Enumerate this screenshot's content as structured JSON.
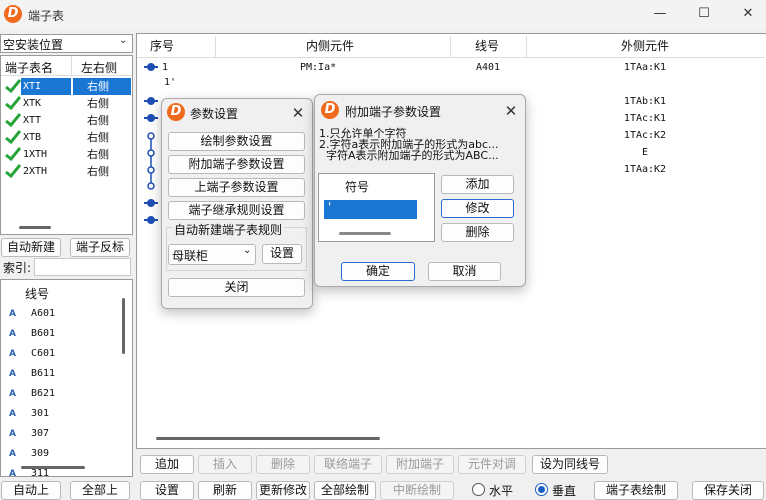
{
  "app": {
    "title": "端子表",
    "logo_letter": "D",
    "min_glyph": "—",
    "max_glyph": "☐",
    "close_glyph": "✕"
  },
  "left": {
    "location_select": "空安装位置",
    "table_headers": [
      "端子表名",
      "左右侧"
    ],
    "tables": [
      {
        "name": "XTI",
        "side": "右侧"
      },
      {
        "name": "XTK",
        "side": "右侧"
      },
      {
        "name": "XTT",
        "side": "右侧"
      },
      {
        "name": "XTB",
        "side": "右侧"
      },
      {
        "name": "1XTH",
        "side": "右侧"
      },
      {
        "name": "2XTH",
        "side": "右侧"
      }
    ],
    "auto_new_label": "自动新建",
    "reverse_label": "端子反标",
    "index_label": "索引:",
    "index_value": "",
    "wire_header": "线号",
    "wire_marker": "A",
    "wires": [
      "A601",
      "B601",
      "C601",
      "B611",
      "B621",
      "301",
      "307",
      "309",
      "311"
    ],
    "auto_up_label": "自动上",
    "all_up_label": "全部上"
  },
  "grid": {
    "headers": [
      "序号",
      "内侧元件",
      "线号",
      "外侧元件"
    ],
    "rows": [
      {
        "seq": "1",
        "inner": "PM:Ia*",
        "wire": "A401",
        "outer": "1TAa:K1"
      },
      {
        "seq": "1'",
        "inner": "",
        "wire": "",
        "outer": ""
      },
      {
        "seq": "",
        "inner": "",
        "wire": "",
        "outer": "1TAb:K1"
      },
      {
        "seq": "",
        "inner": "",
        "wire": "",
        "outer": "1TAc:K1"
      },
      {
        "seq": "",
        "inner": "",
        "wire": "",
        "outer": "1TAc:K2"
      },
      {
        "seq": "",
        "inner": "",
        "wire": "",
        "outer": "E"
      },
      {
        "seq": "",
        "inner": "",
        "wire": "",
        "outer": "1TAa:K2"
      }
    ]
  },
  "toolbar1": [
    "追加",
    "插入",
    "删除",
    "联络端子",
    "附加端子",
    "元件对调",
    "设为同线号"
  ],
  "toolbar2": {
    "buttons": [
      "设置",
      "刷新",
      "更新修改",
      "全部绘制",
      "中断绘制"
    ],
    "radio_horizontal": "水平",
    "radio_vertical": "垂直",
    "draw_table": "端子表绘制",
    "save_close": "保存关闭"
  },
  "settings_dialog": {
    "title": "参数设置",
    "buttons": [
      "绘制参数设置",
      "附加端子参数设置",
      "上端子参数设置",
      "端子继承规则设置"
    ],
    "group_label": "自动新建端子表规则",
    "rule_value": "母联柜",
    "set_label": "设置",
    "close_label": "关闭"
  },
  "extra_dialog": {
    "title": "附加端子参数设置",
    "notes": [
      "1.只允许单个字符",
      "2.字符a表示附加端子的形式为abc...",
      "  字符A表示附加端子的形式为ABC..."
    ],
    "list_header": "符号",
    "list_items": [
      "'"
    ],
    "add_label": "添加",
    "modify_label": "修改",
    "delete_label": "删除",
    "ok_label": "确定",
    "cancel_label": "取消"
  },
  "colors": {
    "selection": "#1976d2",
    "check_green": "#27a33a",
    "logo_orange": "#f06a1d",
    "marker_blue": "#1f4fb5"
  }
}
